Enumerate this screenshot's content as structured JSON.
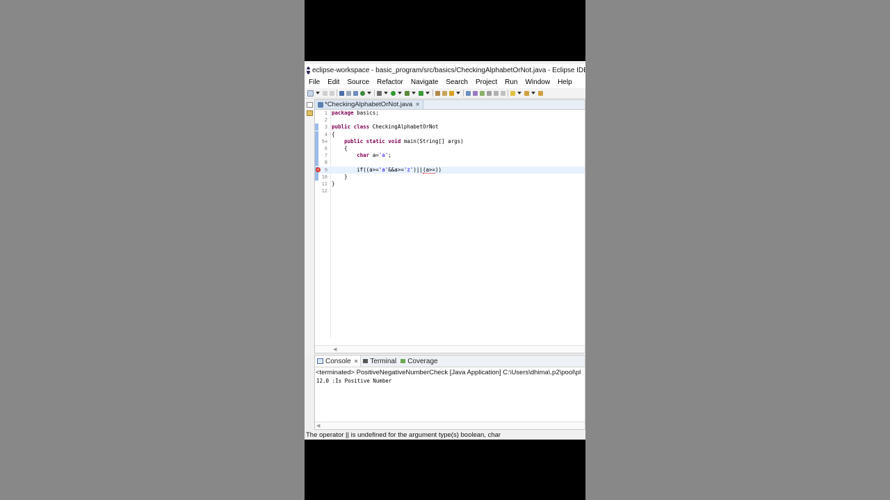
{
  "window": {
    "title": "eclipse-workspace - basic_program/src/basics/CheckingAlphabetOrNot.java - Eclipse IDE",
    "app_icon": "eclipse-icon"
  },
  "menu": [
    "File",
    "Edit",
    "Source",
    "Refactor",
    "Navigate",
    "Search",
    "Project",
    "Run",
    "Window",
    "Help"
  ],
  "editor": {
    "tab_label": "*CheckingAlphabetOrNot.java",
    "tab_close": "✕",
    "lines": [
      {
        "n": "1",
        "parts": [
          {
            "t": "package",
            "k": "kw"
          },
          {
            "t": " basics;"
          }
        ]
      },
      {
        "n": "2",
        "parts": []
      },
      {
        "n": "3",
        "parts": [
          {
            "t": "public",
            "k": "kw"
          },
          {
            "t": " "
          },
          {
            "t": "class",
            "k": "kw"
          },
          {
            "t": " CheckingAlphabetOrNot"
          }
        ]
      },
      {
        "n": "4",
        "parts": [
          {
            "t": "{"
          }
        ]
      },
      {
        "n": "5⊖",
        "parts": [
          {
            "t": "    "
          },
          {
            "t": "public",
            "k": "kw"
          },
          {
            "t": " "
          },
          {
            "t": "static",
            "k": "kw"
          },
          {
            "t": " "
          },
          {
            "t": "void",
            "k": "kw"
          },
          {
            "t": " main(String[] args)"
          }
        ]
      },
      {
        "n": "6",
        "parts": [
          {
            "t": "    {"
          }
        ]
      },
      {
        "n": "7",
        "parts": [
          {
            "t": "        "
          },
          {
            "t": "char",
            "k": "kw"
          },
          {
            "t": " a="
          },
          {
            "t": "'a'",
            "k": "str"
          },
          {
            "t": ";"
          }
        ]
      },
      {
        "n": "8",
        "parts": []
      },
      {
        "n": "9",
        "parts": [
          {
            "t": "        if((a>="
          },
          {
            "t": "'a'",
            "k": "str"
          },
          {
            "t": "&&a>="
          },
          {
            "t": "'z'",
            "k": "str"
          },
          {
            "t": ")||"
          },
          {
            "t": "(a>=",
            "k": "errsq"
          },
          {
            "t": "))"
          }
        ]
      },
      {
        "n": "10",
        "parts": [
          {
            "t": "    }"
          }
        ]
      },
      {
        "n": "11",
        "parts": [
          {
            "t": "}"
          }
        ]
      },
      {
        "n": "12",
        "parts": []
      }
    ],
    "current_line": 9,
    "error_line": 9,
    "scroll_left_arrow": "◀"
  },
  "console": {
    "tabs": [
      {
        "label": "Console",
        "icon": "console-icon",
        "close": "✕"
      },
      {
        "label": "Terminal",
        "icon": "terminal-icon"
      },
      {
        "label": "Coverage",
        "icon": "coverage-icon"
      }
    ],
    "launch_label": "<terminated> PositiveNegativeNumberCheck [Java Application] C:\\Users\\dhima\\.p2\\pool\\pl",
    "output": "12.0 :Is Positive Number",
    "scroll_left_arrow": "◀"
  },
  "status": {
    "message": "The operator || is undefined for the argument type(s) boolean, char"
  },
  "colors": {
    "keyword": "#7f0055",
    "string": "#2a00ff",
    "current_line": "#e8f2fe",
    "error": "#d9332c"
  }
}
